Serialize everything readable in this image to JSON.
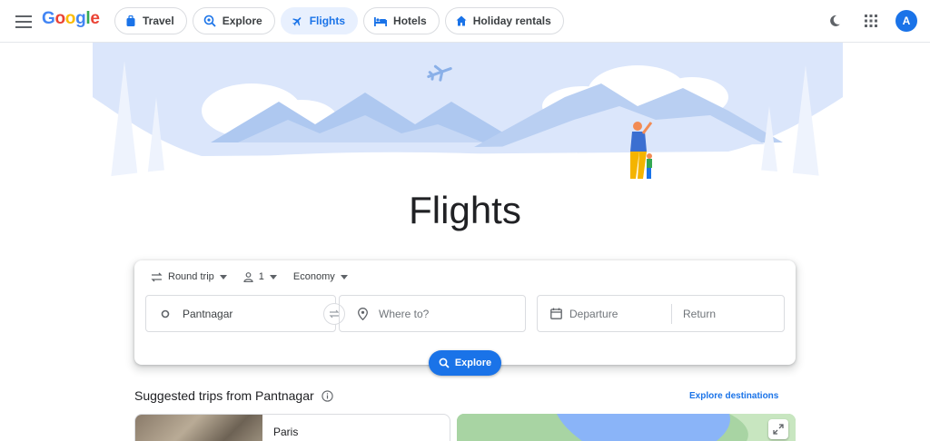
{
  "header": {
    "logo": "Google",
    "tabs": [
      {
        "label": "Travel",
        "icon": "suitcase-icon",
        "active": false
      },
      {
        "label": "Explore",
        "icon": "explore-icon",
        "active": false
      },
      {
        "label": "Flights",
        "icon": "plane-icon",
        "active": true
      },
      {
        "label": "Hotels",
        "icon": "bed-icon",
        "active": false
      },
      {
        "label": "Holiday rentals",
        "icon": "house-icon",
        "active": false
      }
    ],
    "avatar_letter": "A"
  },
  "page_title": "Flights",
  "search": {
    "trip_type": "Round trip",
    "passengers": "1",
    "cabin_class": "Economy",
    "origin": "Pantnagar",
    "destination_placeholder": "Where to?",
    "departure_placeholder": "Departure",
    "return_placeholder": "Return",
    "explore_label": "Explore"
  },
  "suggested": {
    "title": "Suggested trips from Pantnagar",
    "explore_destinations": "Explore destinations",
    "trips": [
      {
        "name": "Paris"
      }
    ]
  },
  "colors": {
    "accent": "#1a73e8",
    "hero_sky": "#dbe6fb",
    "hero_mountain": "#aec8f0"
  }
}
